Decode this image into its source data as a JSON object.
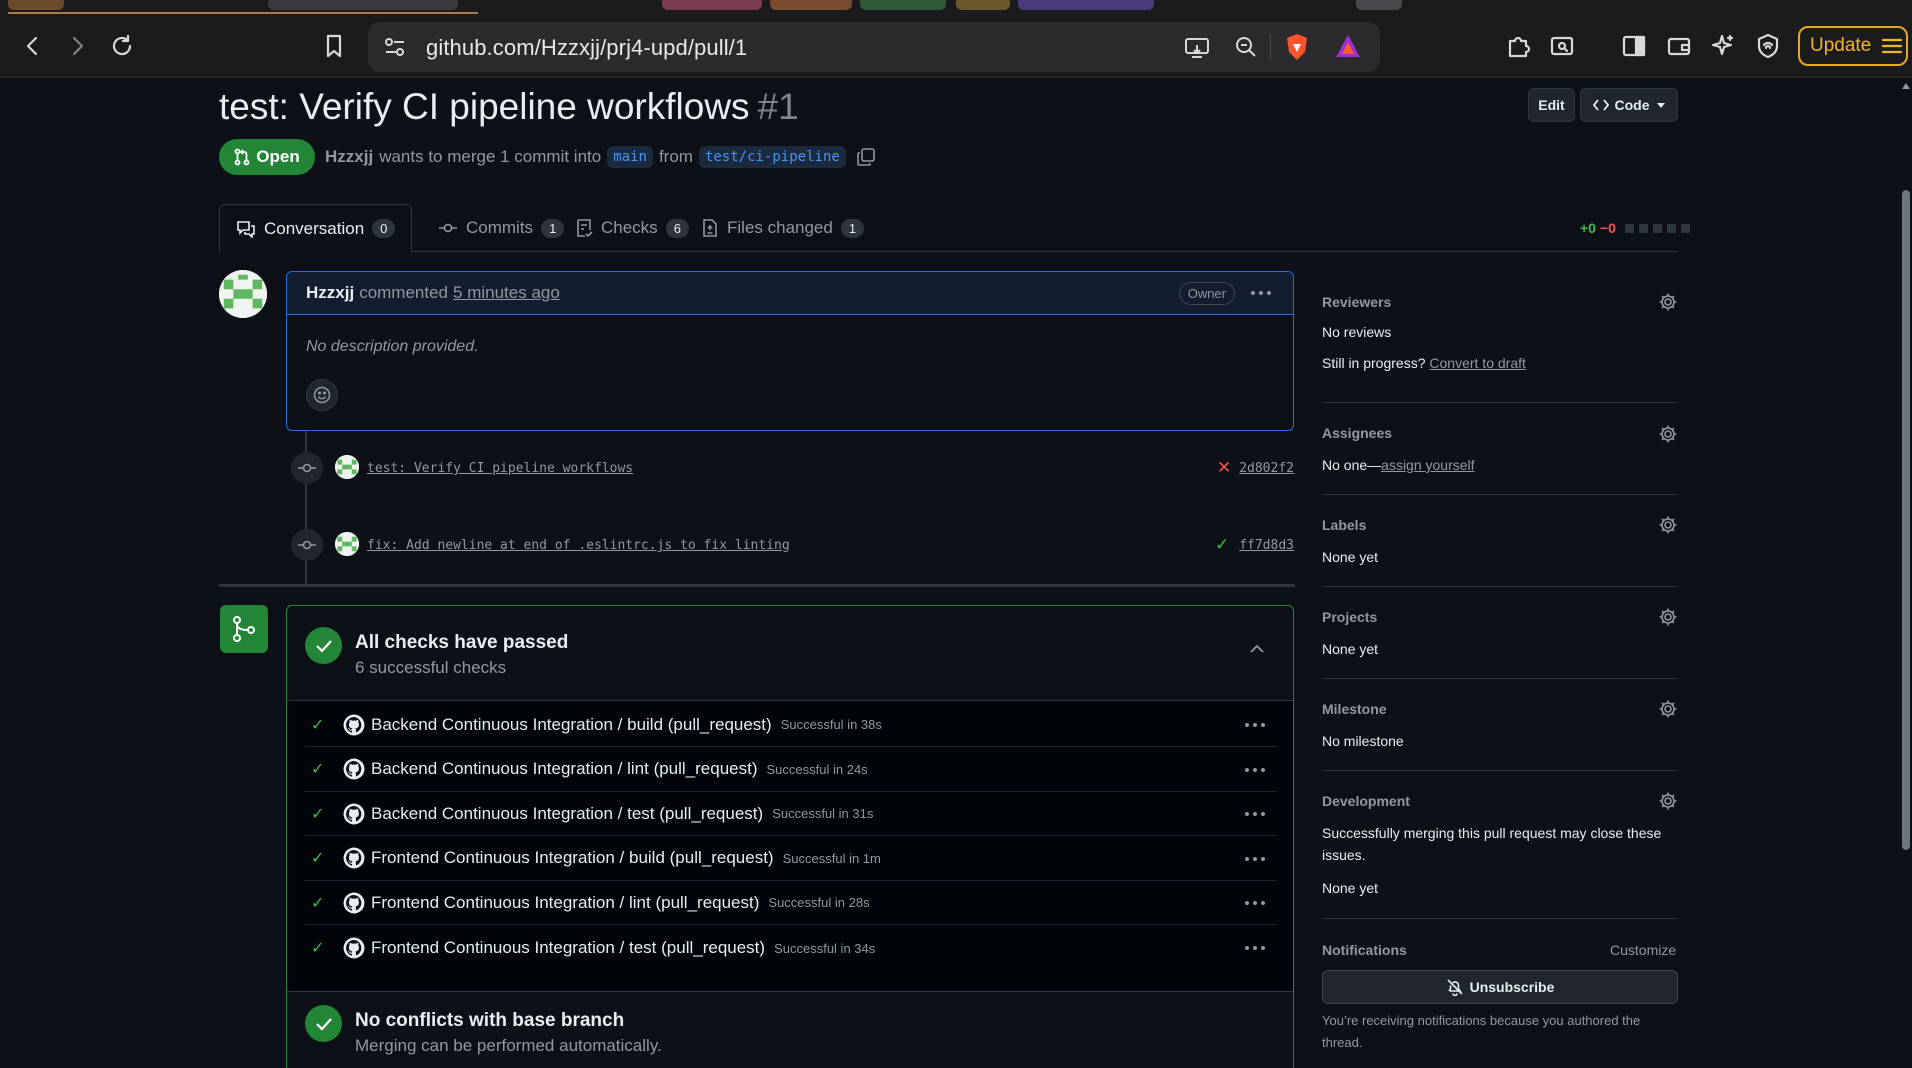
{
  "browser": {
    "url": "github.com/Hzzxjj/prj4-upd/pull/1",
    "update_label": "Update"
  },
  "pr": {
    "title": "test: Verify CI pipeline workflows",
    "number": "#1",
    "edit_label": "Edit",
    "code_label": "Code",
    "state": "Open",
    "author": "Hzzxjj",
    "merge_text": "wants to merge 1 commit into",
    "base_branch": "main",
    "from_text": "from",
    "head_branch": "test/ci-pipeline"
  },
  "tabs": [
    {
      "label": "Conversation",
      "count": "0"
    },
    {
      "label": "Commits",
      "count": "1"
    },
    {
      "label": "Checks",
      "count": "6"
    },
    {
      "label": "Files changed",
      "count": "1"
    }
  ],
  "diffstat": {
    "added": "+0",
    "removed": "−0"
  },
  "comment": {
    "author": "Hzzxjj",
    "action": "commented",
    "time": "5 minutes ago",
    "role": "Owner",
    "body": "No description provided."
  },
  "commits": [
    {
      "message": "test: Verify CI pipeline workflows",
      "sha": "2d802f2",
      "status": "fail",
      "status_glyph": "✕"
    },
    {
      "message": "fix: Add newline at end of .eslintrc.js to fix linting",
      "sha": "ff7d8d3",
      "status": "pass",
      "status_glyph": "✓"
    }
  ],
  "checks": {
    "title": "All checks have passed",
    "subtitle": "6 successful checks",
    "items": [
      {
        "name": "Backend Continuous Integration / build (pull_request)",
        "time": "Successful in 38s"
      },
      {
        "name": "Backend Continuous Integration / lint (pull_request)",
        "time": "Successful in 24s"
      },
      {
        "name": "Backend Continuous Integration / test (pull_request)",
        "time": "Successful in 31s"
      },
      {
        "name": "Frontend Continuous Integration / build (pull_request)",
        "time": "Successful in 1m"
      },
      {
        "name": "Frontend Continuous Integration / lint (pull_request)",
        "time": "Successful in 28s"
      },
      {
        "name": "Frontend Continuous Integration / test (pull_request)",
        "time": "Successful in 34s"
      }
    ],
    "conflicts_title": "No conflicts with base branch",
    "conflicts_sub": "Merging can be performed automatically."
  },
  "sidebar": {
    "reviewers": {
      "heading": "Reviewers",
      "value": "No reviews",
      "progress_text": "Still in progress?",
      "progress_link": "Convert to draft"
    },
    "assignees": {
      "heading": "Assignees",
      "value": "No one—",
      "link": "assign yourself"
    },
    "labels": {
      "heading": "Labels",
      "value": "None yet"
    },
    "projects": {
      "heading": "Projects",
      "value": "None yet"
    },
    "milestone": {
      "heading": "Milestone",
      "value": "No milestone"
    },
    "development": {
      "heading": "Development",
      "note": "Successfully merging this pull request may close these issues.",
      "value": "None yet"
    },
    "notifications": {
      "heading": "Notifications",
      "customize": "Customize",
      "button": "Unsubscribe",
      "note": "You’re receiving notifications because you authored the thread."
    }
  },
  "colors": {
    "accent": "#1f6feb",
    "success": "#238636",
    "success_fg": "#3fb950",
    "danger": "#f85149"
  }
}
